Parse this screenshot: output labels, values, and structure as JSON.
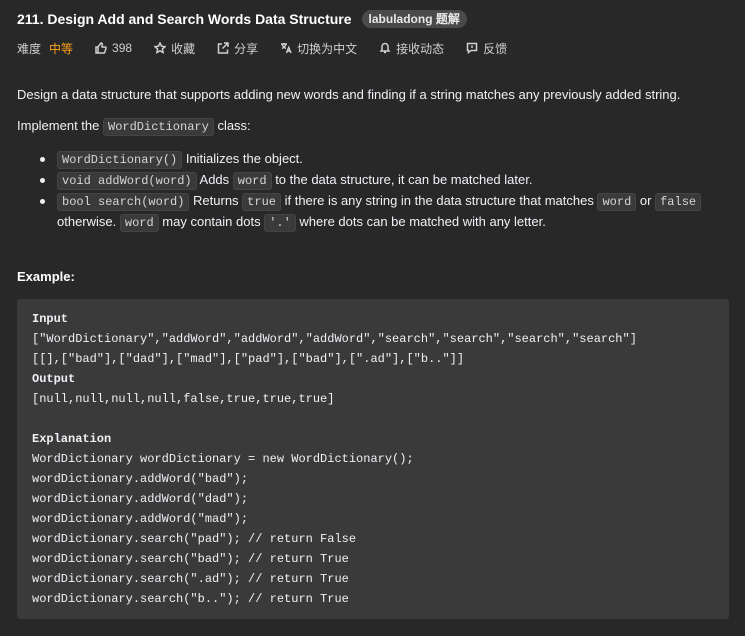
{
  "header": {
    "title": "211. Design Add and Search Words Data Structure",
    "badge": "labuladong 题解"
  },
  "meta": {
    "difficulty_label": "难度",
    "difficulty_value": "中等",
    "likes": "398",
    "favorite": "收藏",
    "share": "分享",
    "translate": "切换为中文",
    "notify": "接收动态",
    "feedback": "反馈"
  },
  "description": {
    "intro": "Design a data structure that supports adding new words and finding if a string matches any previously added string.",
    "impl_prefix": "Implement the ",
    "impl_class": "WordDictionary",
    "impl_suffix": " class:",
    "bullets": [
      {
        "code": "WordDictionary()",
        "text": " Initializes the object."
      },
      {
        "code": "void addWord(word)",
        "text1": " Adds ",
        "code2": "word",
        "text2": " to the data structure, it can be matched later."
      },
      {
        "code": "bool search(word)",
        "text1": " Returns ",
        "code2": "true",
        "text2": " if there is any string in the data structure that matches ",
        "code3": "word",
        "text3": " or ",
        "code4": "false",
        "text4": "otherwise. ",
        "code5": "word",
        "text5": " may contain dots ",
        "code6": "'.'",
        "text6": " where dots can be matched with any letter."
      }
    ]
  },
  "example": {
    "title": "Example:",
    "input_label": "Input",
    "input_line1": "[\"WordDictionary\",\"addWord\",\"addWord\",\"addWord\",\"search\",\"search\",\"search\",\"search\"]",
    "input_line2": "[[],[\"bad\"],[\"dad\"],[\"mad\"],[\"pad\"],[\"bad\"],[\".ad\"],[\"b..\"]]",
    "output_label": "Output",
    "output_line": "[null,null,null,null,false,true,true,true]",
    "explanation_label": "Explanation",
    "explanation_lines": [
      "WordDictionary wordDictionary = new WordDictionary();",
      "wordDictionary.addWord(\"bad\");",
      "wordDictionary.addWord(\"dad\");",
      "wordDictionary.addWord(\"mad\");",
      "wordDictionary.search(\"pad\"); // return False",
      "wordDictionary.search(\"bad\"); // return True",
      "wordDictionary.search(\".ad\"); // return True",
      "wordDictionary.search(\"b..\"); // return True"
    ]
  },
  "colors": {
    "background": "#282828",
    "difficulty_medium": "#ffa116",
    "code_block_bg": "#3a3a3a"
  },
  "icons": [
    "thumbs-up-icon",
    "star-icon",
    "share-icon",
    "translate-icon",
    "bell-icon",
    "feedback-icon"
  ]
}
